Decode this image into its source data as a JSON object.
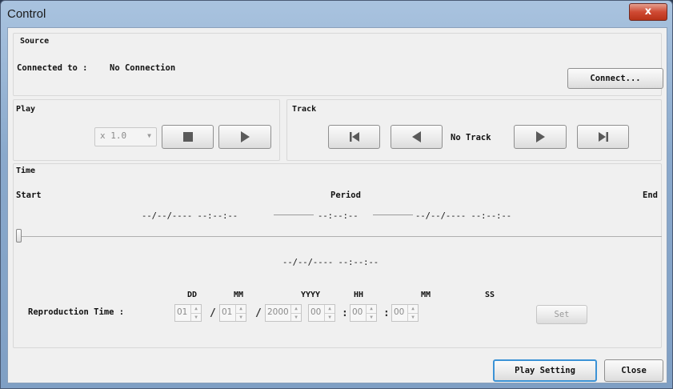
{
  "window": {
    "title": "Control",
    "close_glyph": "x"
  },
  "source": {
    "group_label": "Source",
    "connected_label": "Connected to :",
    "connection_value": "No Connection",
    "connect_button": "Connect..."
  },
  "play": {
    "group_label": "Play",
    "speed": "x 1.0",
    "stop_icon": "stop-icon",
    "play_icon": "play-icon"
  },
  "track": {
    "group_label": "Track",
    "status": "No Track"
  },
  "time": {
    "group_label": "Time",
    "start_label": "Start",
    "period_label": "Period",
    "end_label": "End",
    "start_value": "--/--/---- --:--:--",
    "period_value": "--:--:--",
    "end_value": "--/--/---- --:--:--",
    "current_value": "--/--/---- --:--:--",
    "slider_position": 0
  },
  "reproduction": {
    "label": "Reproduction Time :",
    "headers": {
      "day": "DD",
      "month": "MM",
      "year": "YYYY",
      "hour": "HH",
      "minute": "MM",
      "second": "SS"
    },
    "values": {
      "day": "01",
      "month": "01",
      "year": "2000",
      "hour": "00",
      "minute": "00",
      "second": "00"
    },
    "date_separator": "/",
    "time_separator": ":",
    "set_button": "Set"
  },
  "footer": {
    "play_setting_button": "Play Setting",
    "close_button": "Close"
  }
}
